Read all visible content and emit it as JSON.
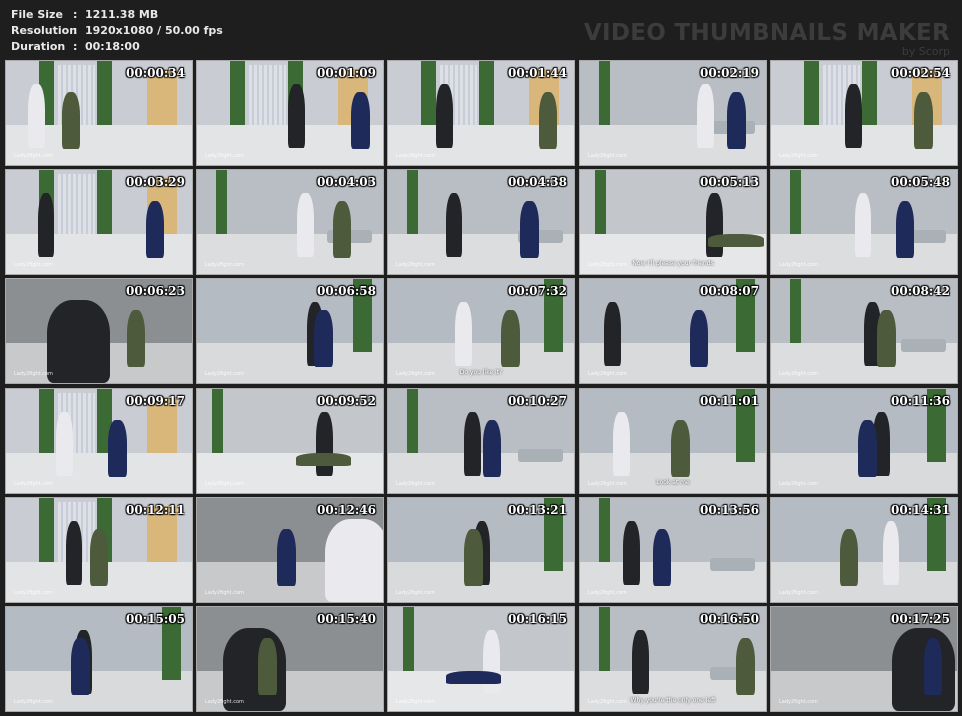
{
  "header": {
    "file_size_label": "File Size",
    "file_size_value": "1211.38 MB",
    "resolution_label": "Resolution",
    "resolution_value": "1920x1080 / 50.00 fps",
    "duration_label": "Duration",
    "duration_value": "00:18:00",
    "separator": ":"
  },
  "brand": {
    "title": "VIDEO THUMBNAILS MAKER",
    "subtitle": "by Scorp"
  },
  "watermark": "Lady2fight.com",
  "thumbnails": [
    {
      "time": "00:00:34",
      "scene": "room-curtain",
      "caption": ""
    },
    {
      "time": "00:01:09",
      "scene": "room-curtain",
      "caption": ""
    },
    {
      "time": "00:01:44",
      "scene": "room-curtain",
      "caption": ""
    },
    {
      "time": "00:02:19",
      "scene": "room-gray",
      "caption": ""
    },
    {
      "time": "00:02:54",
      "scene": "room-curtain",
      "caption": ""
    },
    {
      "time": "00:03:29",
      "scene": "room-curtain",
      "caption": ""
    },
    {
      "time": "00:04:03",
      "scene": "room-gray",
      "caption": ""
    },
    {
      "time": "00:04:38",
      "scene": "room-gray",
      "caption": ""
    },
    {
      "time": "00:05:13",
      "scene": "floor",
      "caption": "Now I'll please your friends"
    },
    {
      "time": "00:05:48",
      "scene": "room-gray",
      "caption": ""
    },
    {
      "time": "00:06:23",
      "scene": "closeup",
      "caption": ""
    },
    {
      "time": "00:06:58",
      "scene": "wall",
      "caption": ""
    },
    {
      "time": "00:07:32",
      "scene": "wall",
      "caption": "Do you like it?"
    },
    {
      "time": "00:08:07",
      "scene": "wall",
      "caption": ""
    },
    {
      "time": "00:08:42",
      "scene": "room-gray",
      "caption": ""
    },
    {
      "time": "00:09:17",
      "scene": "room-curtain",
      "caption": ""
    },
    {
      "time": "00:09:52",
      "scene": "floor",
      "caption": ""
    },
    {
      "time": "00:10:27",
      "scene": "room-gray",
      "caption": ""
    },
    {
      "time": "00:11:01",
      "scene": "wall",
      "caption": "Look at me"
    },
    {
      "time": "00:11:36",
      "scene": "wall",
      "caption": ""
    },
    {
      "time": "00:12:11",
      "scene": "room-curtain",
      "caption": ""
    },
    {
      "time": "00:12:46",
      "scene": "closeup",
      "caption": ""
    },
    {
      "time": "00:13:21",
      "scene": "wall",
      "caption": ""
    },
    {
      "time": "00:13:56",
      "scene": "room-gray",
      "caption": ""
    },
    {
      "time": "00:14:31",
      "scene": "wall",
      "caption": ""
    },
    {
      "time": "00:15:05",
      "scene": "wall",
      "caption": ""
    },
    {
      "time": "00:15:40",
      "scene": "closeup",
      "caption": ""
    },
    {
      "time": "00:16:15",
      "scene": "floor",
      "caption": ""
    },
    {
      "time": "00:16:50",
      "scene": "room-gray",
      "caption": "Why you're the only one left"
    },
    {
      "time": "00:17:25",
      "scene": "closeup",
      "caption": ""
    }
  ]
}
